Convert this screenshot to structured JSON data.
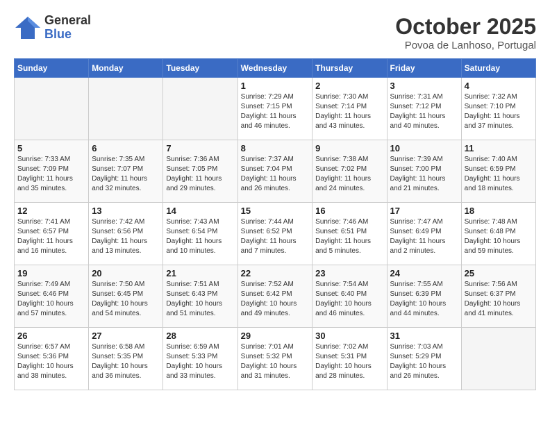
{
  "header": {
    "logo_general": "General",
    "logo_blue": "Blue",
    "title": "October 2025",
    "subtitle": "Povoa de Lanhoso, Portugal"
  },
  "weekdays": [
    "Sunday",
    "Monday",
    "Tuesday",
    "Wednesday",
    "Thursday",
    "Friday",
    "Saturday"
  ],
  "weeks": [
    [
      {
        "day": "",
        "info": ""
      },
      {
        "day": "",
        "info": ""
      },
      {
        "day": "",
        "info": ""
      },
      {
        "day": "1",
        "info": "Sunrise: 7:29 AM\nSunset: 7:15 PM\nDaylight: 11 hours\nand 46 minutes."
      },
      {
        "day": "2",
        "info": "Sunrise: 7:30 AM\nSunset: 7:14 PM\nDaylight: 11 hours\nand 43 minutes."
      },
      {
        "day": "3",
        "info": "Sunrise: 7:31 AM\nSunset: 7:12 PM\nDaylight: 11 hours\nand 40 minutes."
      },
      {
        "day": "4",
        "info": "Sunrise: 7:32 AM\nSunset: 7:10 PM\nDaylight: 11 hours\nand 37 minutes."
      }
    ],
    [
      {
        "day": "5",
        "info": "Sunrise: 7:33 AM\nSunset: 7:09 PM\nDaylight: 11 hours\nand 35 minutes."
      },
      {
        "day": "6",
        "info": "Sunrise: 7:35 AM\nSunset: 7:07 PM\nDaylight: 11 hours\nand 32 minutes."
      },
      {
        "day": "7",
        "info": "Sunrise: 7:36 AM\nSunset: 7:05 PM\nDaylight: 11 hours\nand 29 minutes."
      },
      {
        "day": "8",
        "info": "Sunrise: 7:37 AM\nSunset: 7:04 PM\nDaylight: 11 hours\nand 26 minutes."
      },
      {
        "day": "9",
        "info": "Sunrise: 7:38 AM\nSunset: 7:02 PM\nDaylight: 11 hours\nand 24 minutes."
      },
      {
        "day": "10",
        "info": "Sunrise: 7:39 AM\nSunset: 7:00 PM\nDaylight: 11 hours\nand 21 minutes."
      },
      {
        "day": "11",
        "info": "Sunrise: 7:40 AM\nSunset: 6:59 PM\nDaylight: 11 hours\nand 18 minutes."
      }
    ],
    [
      {
        "day": "12",
        "info": "Sunrise: 7:41 AM\nSunset: 6:57 PM\nDaylight: 11 hours\nand 16 minutes."
      },
      {
        "day": "13",
        "info": "Sunrise: 7:42 AM\nSunset: 6:56 PM\nDaylight: 11 hours\nand 13 minutes."
      },
      {
        "day": "14",
        "info": "Sunrise: 7:43 AM\nSunset: 6:54 PM\nDaylight: 11 hours\nand 10 minutes."
      },
      {
        "day": "15",
        "info": "Sunrise: 7:44 AM\nSunset: 6:52 PM\nDaylight: 11 hours\nand 7 minutes."
      },
      {
        "day": "16",
        "info": "Sunrise: 7:46 AM\nSunset: 6:51 PM\nDaylight: 11 hours\nand 5 minutes."
      },
      {
        "day": "17",
        "info": "Sunrise: 7:47 AM\nSunset: 6:49 PM\nDaylight: 11 hours\nand 2 minutes."
      },
      {
        "day": "18",
        "info": "Sunrise: 7:48 AM\nSunset: 6:48 PM\nDaylight: 10 hours\nand 59 minutes."
      }
    ],
    [
      {
        "day": "19",
        "info": "Sunrise: 7:49 AM\nSunset: 6:46 PM\nDaylight: 10 hours\nand 57 minutes."
      },
      {
        "day": "20",
        "info": "Sunrise: 7:50 AM\nSunset: 6:45 PM\nDaylight: 10 hours\nand 54 minutes."
      },
      {
        "day": "21",
        "info": "Sunrise: 7:51 AM\nSunset: 6:43 PM\nDaylight: 10 hours\nand 51 minutes."
      },
      {
        "day": "22",
        "info": "Sunrise: 7:52 AM\nSunset: 6:42 PM\nDaylight: 10 hours\nand 49 minutes."
      },
      {
        "day": "23",
        "info": "Sunrise: 7:54 AM\nSunset: 6:40 PM\nDaylight: 10 hours\nand 46 minutes."
      },
      {
        "day": "24",
        "info": "Sunrise: 7:55 AM\nSunset: 6:39 PM\nDaylight: 10 hours\nand 44 minutes."
      },
      {
        "day": "25",
        "info": "Sunrise: 7:56 AM\nSunset: 6:37 PM\nDaylight: 10 hours\nand 41 minutes."
      }
    ],
    [
      {
        "day": "26",
        "info": "Sunrise: 6:57 AM\nSunset: 5:36 PM\nDaylight: 10 hours\nand 38 minutes."
      },
      {
        "day": "27",
        "info": "Sunrise: 6:58 AM\nSunset: 5:35 PM\nDaylight: 10 hours\nand 36 minutes."
      },
      {
        "day": "28",
        "info": "Sunrise: 6:59 AM\nSunset: 5:33 PM\nDaylight: 10 hours\nand 33 minutes."
      },
      {
        "day": "29",
        "info": "Sunrise: 7:01 AM\nSunset: 5:32 PM\nDaylight: 10 hours\nand 31 minutes."
      },
      {
        "day": "30",
        "info": "Sunrise: 7:02 AM\nSunset: 5:31 PM\nDaylight: 10 hours\nand 28 minutes."
      },
      {
        "day": "31",
        "info": "Sunrise: 7:03 AM\nSunset: 5:29 PM\nDaylight: 10 hours\nand 26 minutes."
      },
      {
        "day": "",
        "info": ""
      }
    ]
  ]
}
